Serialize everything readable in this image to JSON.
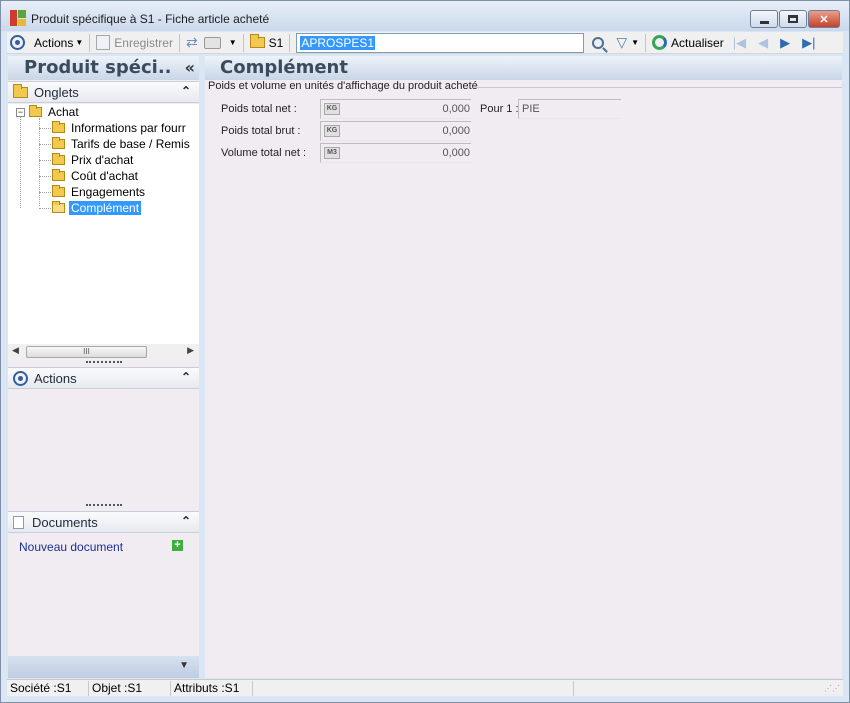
{
  "window": {
    "title": "Produit spécifique à S1 -  Fiche article acheté",
    "minimize_label": "",
    "maximize_label": "",
    "close_label": "✕"
  },
  "toolbar": {
    "actions_label": "Actions",
    "save_label": "Enregistrer",
    "site_label": "S1",
    "code_value": "APROSPES1",
    "refresh_label": "Actualiser"
  },
  "left_panel": {
    "header": "Produit spéci..",
    "collapse_icon": "«",
    "tabs_section": {
      "title": "Onglets",
      "root": "Achat",
      "items": [
        {
          "label": "Informations par fourr"
        },
        {
          "label": "Tarifs de base / Remis"
        },
        {
          "label": "Prix d'achat"
        },
        {
          "label": "Coût d'achat"
        },
        {
          "label": "Engagements"
        },
        {
          "label": "Complément"
        }
      ],
      "selected": "Complément"
    },
    "scroll_thumb": "III",
    "actions_section": {
      "title": "Actions"
    },
    "documents_section": {
      "title": "Documents",
      "new_document": "Nouveau document"
    }
  },
  "main": {
    "title": "Complément",
    "group_title": "Poids et volume en unités d'affichage du produit acheté",
    "fields": [
      {
        "label": "Poids total net :",
        "unit": "KG",
        "value": "0,000"
      },
      {
        "label": "Poids total brut :",
        "unit": "KG",
        "value": "0,000"
      },
      {
        "label": "Volume total net :",
        "unit": "M3",
        "value": "0,000"
      }
    ],
    "per_unit": {
      "label": "Pour 1 :",
      "value": "PIE"
    }
  },
  "statusbar": {
    "company": "Société :S1",
    "object": "Objet :S1",
    "attributes": "Attributs :S1"
  },
  "icons": {
    "app": "app-icon",
    "toolbar": [
      "actions-circle-icon",
      "save-icon",
      "sync-icon",
      "print-icon",
      "folder-icon",
      "search-icon",
      "filter-icon",
      "refresh-icon",
      "first-icon",
      "previous-icon",
      "next-icon",
      "last-icon"
    ]
  }
}
